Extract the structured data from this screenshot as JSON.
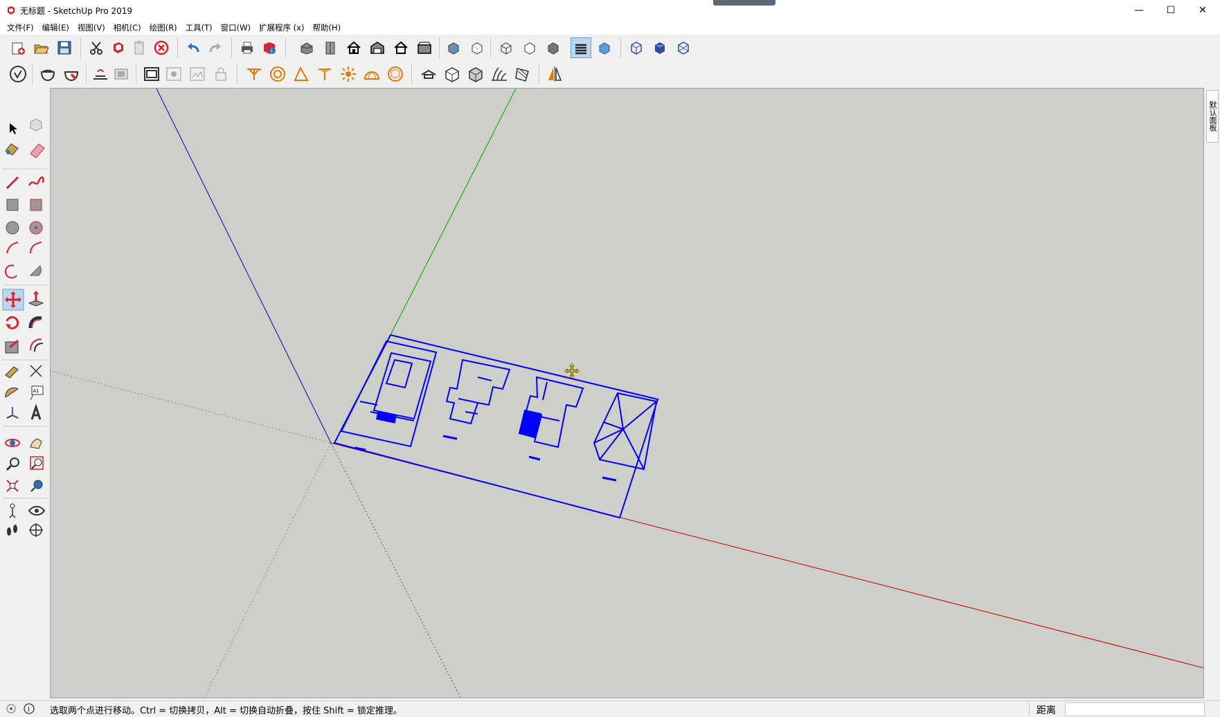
{
  "window": {
    "title": "无标题 - SketchUp Pro 2019",
    "controls": {
      "minimize": "—",
      "maximize": "☐",
      "close": "✕"
    }
  },
  "menu": [
    "文件(F)",
    "编辑(E)",
    "视图(V)",
    "相机(C)",
    "绘图(R)",
    "工具(T)",
    "窗口(W)",
    "扩展程序 (x)",
    "帮助(H)"
  ],
  "toolbar1": {
    "icons": [
      "new-icon",
      "open-icon",
      "save-icon",
      "cut-icon",
      "copy-icon",
      "paste-icon",
      "delete-icon",
      "undo-icon",
      "redo-icon",
      "print-icon",
      "model-info-icon",
      "iso-view-icon",
      "top-view-icon",
      "front-view-icon",
      "right-view-icon",
      "back-view-icon",
      "left-view-icon",
      "xray-icon",
      "back-edges-icon",
      "wireframe-icon",
      "hidden-line-icon",
      "shaded-icon",
      "shaded-textures-icon",
      "monochrome-icon",
      "style-a-icon",
      "style-b-icon",
      "style-c-icon"
    ],
    "active": "shaded-textures-icon"
  },
  "toolbar2": {
    "icons": [
      "warehouse-icon",
      "components-icon",
      "extension-warehouse-icon",
      "sandbox-smoove-icon",
      "sandbox-stamp-icon",
      "section-plane-icon",
      "section-display-icon",
      "section-cut-icon",
      "lock-icon",
      "curve-tool-icon",
      "circle-solid-icon",
      "angle-tool-icon",
      "pole-tool-icon",
      "sun-icon",
      "dome-icon",
      "sphere-icon",
      "camera-icon",
      "box-icon",
      "solid-box-icon",
      "grass-icon",
      "texture-icon",
      "mirror-icon"
    ]
  },
  "left_tools": [
    "select-icon",
    "component-icon",
    "paint-bucket-icon",
    "eraser-icon",
    "line-icon",
    "freehand-icon",
    "rectangle-icon",
    "rotated-rectangle-icon",
    "circle-icon",
    "polygon-icon",
    "arc-icon",
    "two-point-arc-icon",
    "three-point-arc-icon",
    "pie-icon",
    "move-icon",
    "push-pull-icon",
    "rotate-icon",
    "follow-me-icon",
    "scale-icon",
    "offset-icon",
    "tape-measure-icon",
    "dimension-icon",
    "protractor-icon",
    "text-icon",
    "axes-icon",
    "3d-text-icon",
    "orbit-icon",
    "pan-icon",
    "zoom-icon",
    "zoom-window-icon",
    "zoom-extents-icon",
    "previous-view-icon",
    "position-camera-icon",
    "look-around-icon",
    "walk-icon",
    "section-plane-tool-icon"
  ],
  "active_tool": "move-icon",
  "tray_tab": "默认面板",
  "status": {
    "message": "选取两个点进行移动。Ctrl = 切换拷贝，Alt = 切换自动折叠，按住 Shift = 锁定推理。",
    "measure_label": "距离",
    "measure_value": ""
  },
  "colors": {
    "viewport_bg": "#cfcfc9",
    "axis_red": "#c00000",
    "axis_green": "#00a000",
    "axis_blue": "#0000c0",
    "selection_blue": "#0000ff"
  }
}
